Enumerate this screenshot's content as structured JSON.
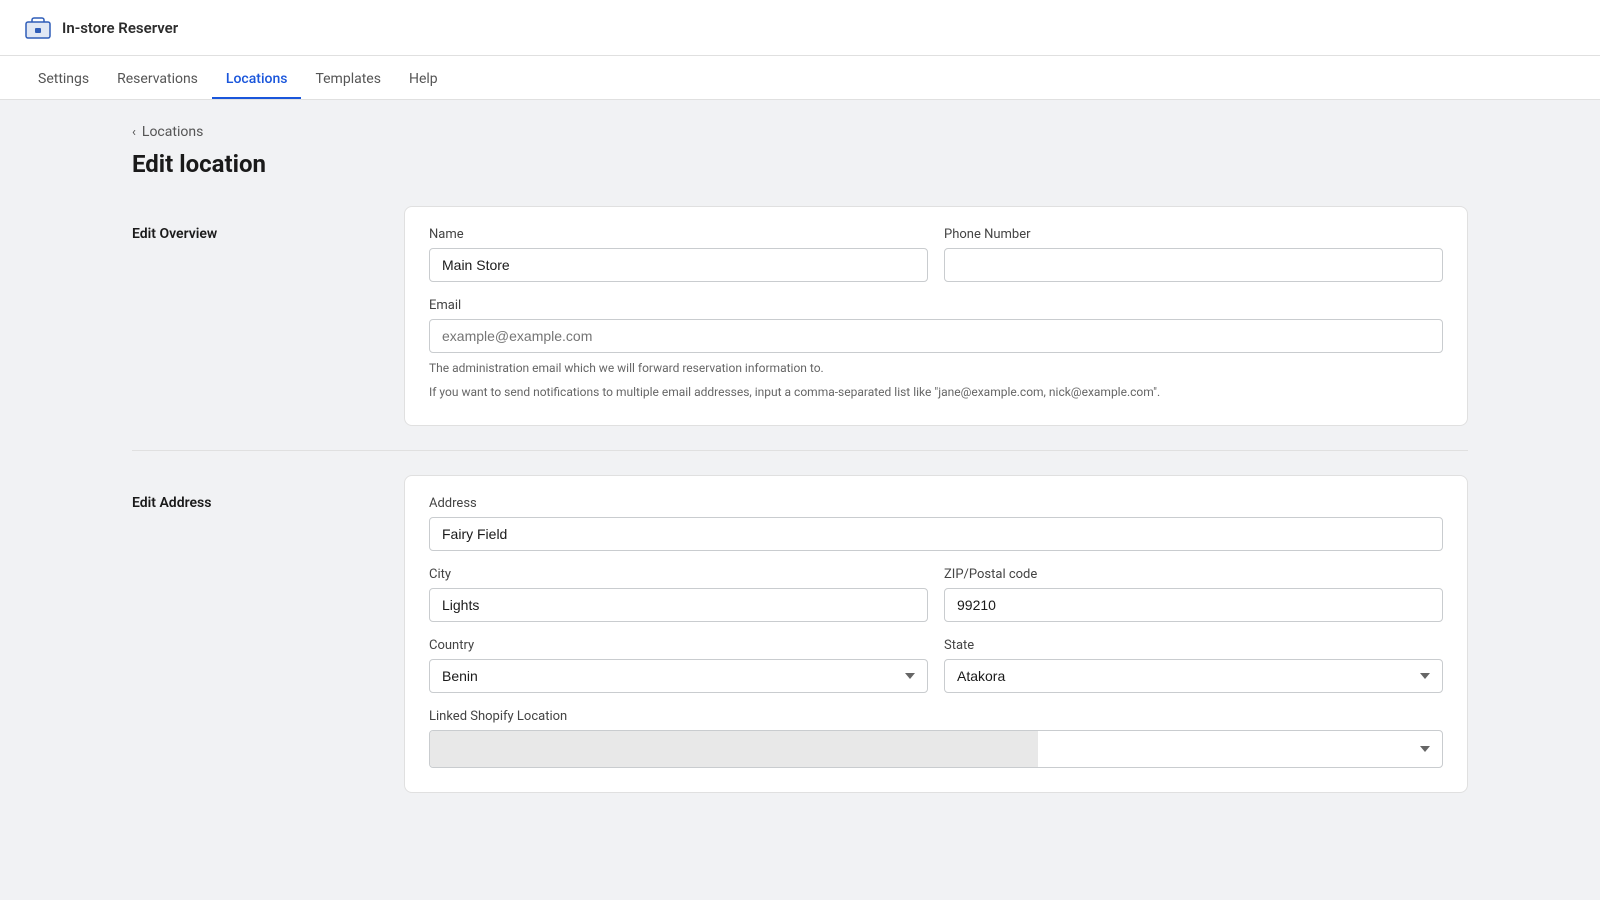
{
  "app": {
    "title": "In-store Reserver"
  },
  "nav": {
    "items": [
      {
        "label": "Settings",
        "active": false
      },
      {
        "label": "Reservations",
        "active": false
      },
      {
        "label": "Locations",
        "active": true
      },
      {
        "label": "Templates",
        "active": false
      },
      {
        "label": "Help",
        "active": false
      }
    ]
  },
  "breadcrumb": {
    "parent": "Locations"
  },
  "page": {
    "title": "Edit location"
  },
  "editOverview": {
    "sectionLabel": "Edit Overview",
    "nameLabel": "Name",
    "nameValue": "Main Store",
    "phoneLabel": "Phone Number",
    "phoneValue": "",
    "emailLabel": "Email",
    "emailPlaceholder": "example@example.com",
    "emailHint1": "The administration email which we will forward reservation information to.",
    "emailHint2": "If you want to send notifications to multiple email addresses, input a comma-separated list like \"jane@example.com, nick@example.com\"."
  },
  "editAddress": {
    "sectionLabel": "Edit Address",
    "addressLabel": "Address",
    "addressValue": "Fairy Field",
    "cityLabel": "City",
    "cityValue": "Lights",
    "zipLabel": "ZIP/Postal code",
    "zipValue": "99210",
    "countryLabel": "Country",
    "countryValue": "Benin",
    "stateLabel": "State",
    "stateValue": "Atakora",
    "linkedLabel": "Linked Shopify Location",
    "linkedValue": ""
  }
}
